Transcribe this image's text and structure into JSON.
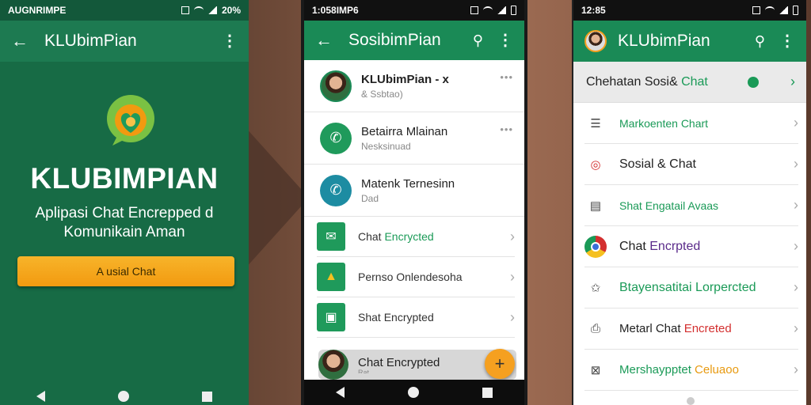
{
  "colors": {
    "brand_green": "#1a8a56",
    "accent_orange": "#f5a020"
  },
  "phone1": {
    "status_left": "AUGNRIMPE",
    "status_right": "20%",
    "appbar_title": "KLUbimPian",
    "brand": "KLUBIMPIAN",
    "tagline_1": "Aplipasi Chat Encrepped d",
    "tagline_2": "Komunikain Aman",
    "cta_label": "A usial Chat"
  },
  "phone2": {
    "status_left": "1:058IMP6",
    "appbar_title": "SosibimPian",
    "chats": [
      {
        "name": "KLUbimPian - x",
        "sub": "& Ssbtao)",
        "avatar": "person"
      },
      {
        "name": "Betairra Mlainan",
        "sub": "Nesksinuad",
        "avatar": "phone-green"
      },
      {
        "name": "Matenk Ternesinn",
        "sub": "Dad",
        "avatar": "phone-teal"
      }
    ],
    "menu": [
      {
        "prefix": "Chat ",
        "highlight": "Encrycted",
        "icon": "chat-icon"
      },
      {
        "prefix": "Pernso Onlendesoha",
        "highlight": "",
        "icon": "alert-icon"
      },
      {
        "prefix": "Shat Encrypted",
        "highlight": "",
        "icon": "document-icon"
      }
    ],
    "bottom_chat": "Chat Encrypted",
    "bottom_sub": "Rat",
    "fab_label": "+"
  },
  "phone3": {
    "status_left": "12:85",
    "appbar_title": "KLUbimPian",
    "header_prefix": "Chehatan Sosi& ",
    "header_highlight": "Chat",
    "rows": [
      {
        "label": "Markoenten Chart",
        "color": "green",
        "icon": "list-icon"
      },
      {
        "label": "Sosial & Chat",
        "color": "dark",
        "icon": "target-icon"
      },
      {
        "label": "Shat Engatail Avaas",
        "color": "green",
        "icon": "clipboard-icon"
      },
      {
        "label_prefix": "Chat ",
        "label": "Encrpted",
        "color": "purple",
        "icon": "chrome-icon"
      },
      {
        "label": "Btayensatitai Lorpercted",
        "color": "green",
        "icon": "star-icon"
      },
      {
        "label_prefix": "Metarl Chat ",
        "label": "Encreted",
        "color": "red",
        "icon": "printer-icon"
      },
      {
        "label_prefix": "Mershaypptet ",
        "label": "Celuaoo",
        "color": "orange",
        "icon": "image-icon"
      }
    ]
  }
}
